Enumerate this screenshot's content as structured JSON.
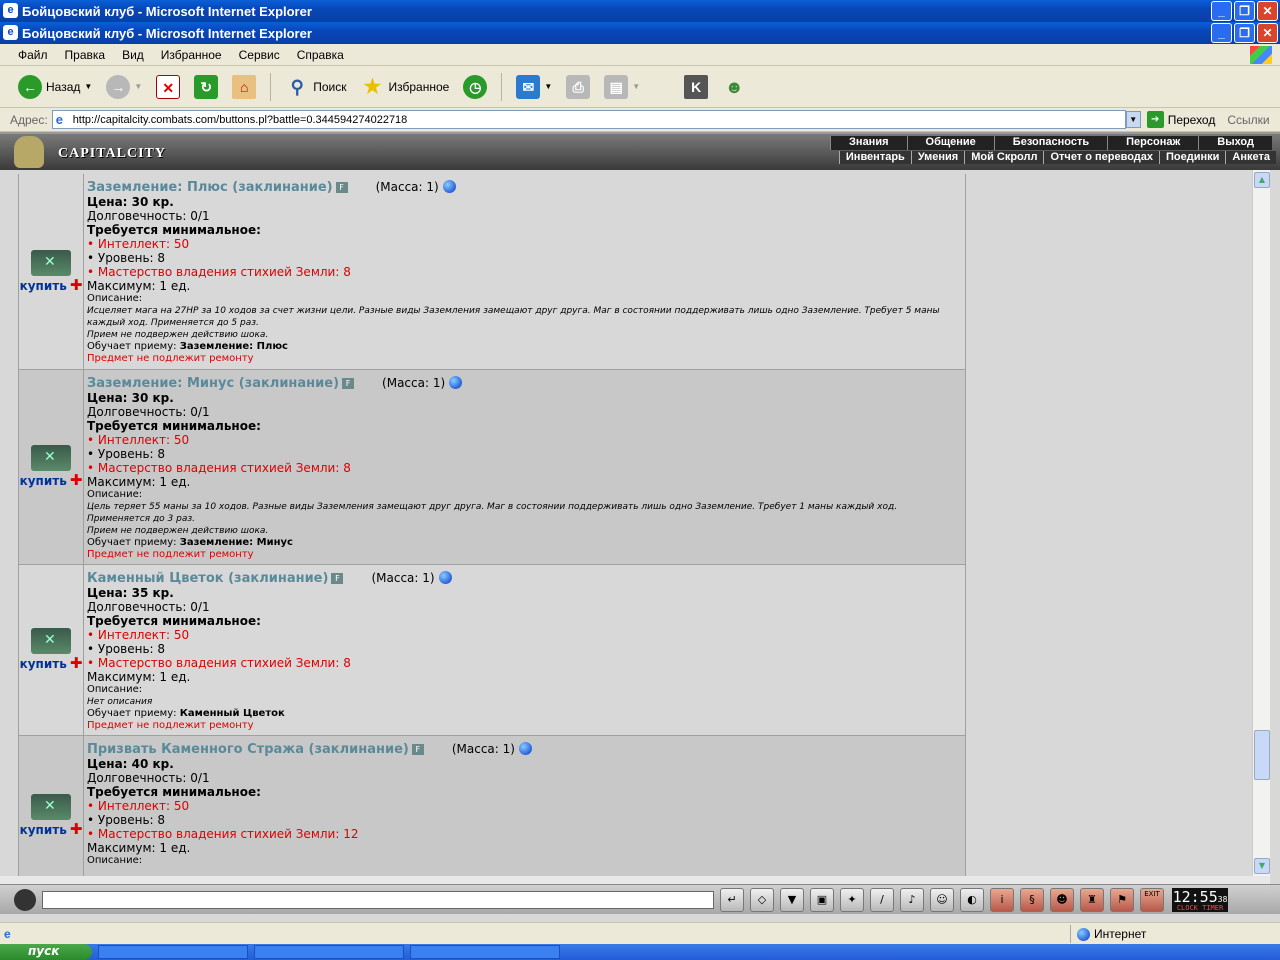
{
  "window": {
    "title": "Бойцовский клуб - Microsoft Internet Explorer",
    "min": "_",
    "max": "❐",
    "close": "✕"
  },
  "menu": [
    "Файл",
    "Правка",
    "Вид",
    "Избранное",
    "Сервис",
    "Справка"
  ],
  "toolbar": {
    "back": "Назад",
    "search": "Поиск",
    "favorites": "Избранное"
  },
  "address": {
    "label": "Адрес:",
    "url": "http://capitalcity.combats.com/buttons.pl?battle=0.344594274022718",
    "go": "Переход",
    "links": "Ссылки"
  },
  "site": {
    "logo_text": "CAPITALCITY",
    "nav_top": [
      "Знания",
      "Общение",
      "Безопасность",
      "Персонаж",
      "Выход"
    ],
    "nav_bottom": [
      "Инвентарь",
      "Умения",
      "Мой Скролл",
      "Отчет о переводах",
      "Поединки",
      "Анкета"
    ]
  },
  "labels": {
    "buy": "купить",
    "plus": "✚",
    "f": "F",
    "requires": "Требуется минимальное:",
    "desc_label": "Описание:",
    "no_repair": "Предмет не подлежит ремонту"
  },
  "items": [
    {
      "name": "Заземление: Плюс (заклинание)",
      "mass": "(Масса: 1)",
      "price": "Цена: 30 кр.",
      "durability": "Долговечность: 0/1",
      "req_int": "• Интеллект: 50",
      "req_lvl": "• Уровень: 8",
      "req_earth": "• Мастерство владения стихией Земли: 8",
      "max": "Максимум: 1 ед.",
      "desc": "Исцеляет мага на 27HP за 10 ходов за счет жизни цели. Разные виды Заземления замещают друг друга. Маг в состоянии поддерживать лишь одно Заземление. Требует 5 маны каждый ход. Применяется до 5 раз.",
      "shock": "Прием не подвержен действию шока.",
      "teaches_label": "Обучает приему:",
      "teaches": "Заземление: Плюс"
    },
    {
      "name": "Заземление: Минус (заклинание)",
      "mass": "(Масса: 1)",
      "price": "Цена: 30 кр.",
      "durability": "Долговечность: 0/1",
      "req_int": "• Интеллект: 50",
      "req_lvl": "• Уровень: 8",
      "req_earth": "• Мастерство владения стихией Земли: 8",
      "max": "Максимум: 1 ед.",
      "desc": "Цель теряет 55 маны за 10 ходов. Разные виды Заземления замещают друг друга. Маг в состоянии поддерживать лишь одно Заземление. Требует 1 маны каждый ход. Применяется до 3 раз.",
      "shock": "Прием не подвержен действию шока.",
      "teaches_label": "Обучает приему:",
      "teaches": "Заземление: Минус"
    },
    {
      "name": "Каменный Цветок (заклинание)",
      "mass": "(Масса: 1)",
      "price": "Цена: 35 кр.",
      "durability": "Долговечность: 0/1",
      "req_int": "• Интеллект: 50",
      "req_lvl": "• Уровень: 8",
      "req_earth": "• Мастерство владения стихией Земли: 8",
      "max": "Максимум: 1 ед.",
      "desc": "Нет описания",
      "shock": "",
      "teaches_label": "Обучает приему:",
      "teaches": "Каменный Цветок"
    },
    {
      "name": "Призвать Каменного Стража (заклинание)",
      "mass": "(Масса: 1)",
      "price": "Цена: 40 кр.",
      "durability": "Долговечность: 0/1",
      "req_int": "• Интеллект: 50",
      "req_lvl": "• Уровень: 8",
      "req_earth": "• Мастерство владения стихией Земли: 12",
      "max": "Максимум: 1 ед.",
      "desc": "",
      "shock": "",
      "teaches_label": "",
      "teaches": ""
    }
  ],
  "chat": {
    "clock": "12:55",
    "clock_sec": "38",
    "clock_labels": "CLOCK TIMER",
    "exit": "EXIT"
  },
  "status": {
    "zone": "Интернет"
  },
  "taskbar": {
    "start": "пуск"
  }
}
